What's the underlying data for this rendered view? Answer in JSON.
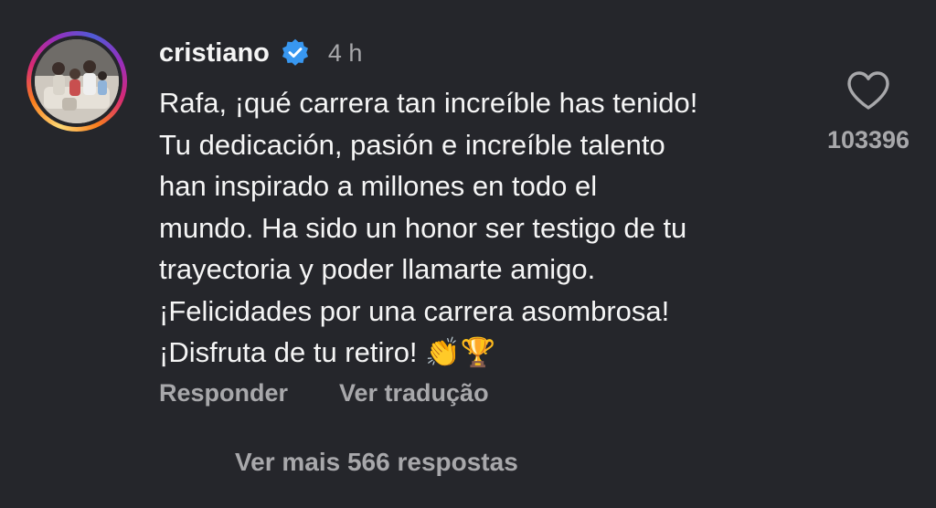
{
  "comment": {
    "username": "cristiano",
    "verified_icon": "verified-badge-icon",
    "time": "4 h",
    "text": "Rafa, ¡qué carrera tan increíble has tenido!\nTu dedicación, pasión e increíble talento\nhan inspirado a millones en todo el\nmundo. Ha sido un honor ser testigo de tu\ntrayectoria y poder llamarte amigo.\n¡Felicidades por una carrera asombrosa!\n¡Disfruta de tu retiro! 👏🏆",
    "like_icon": "heart-outline-icon",
    "like_count": "103396",
    "reply_label": "Responder",
    "translate_label": "Ver tradução",
    "more_replies_label": "Ver mais 566 respostas"
  },
  "colors": {
    "background": "#25262b",
    "text_primary": "#f5f5f5",
    "text_secondary": "#a8a8ab",
    "verified": "#3897f0"
  }
}
